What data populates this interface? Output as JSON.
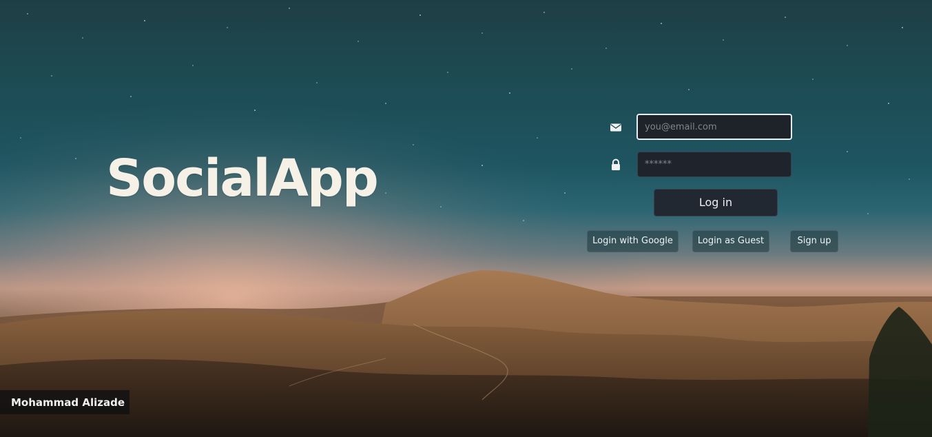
{
  "brand": {
    "title": "SocialApp"
  },
  "login_form": {
    "email_placeholder": "you@email.com",
    "email_value": "",
    "password_placeholder": "******",
    "password_value": "",
    "submit_label": "Log in"
  },
  "alt_actions": {
    "google_label": "Login with Google",
    "guest_label": "Login as Guest",
    "signup_label": "Sign up"
  },
  "photo_credit": {
    "icon": "camera-icon",
    "author": "Mohammad Alizade"
  },
  "icons": {
    "email": "envelope-icon",
    "password": "lock-icon"
  },
  "colors": {
    "brand_text": "#f6f1e6",
    "field_bg": "#1f232b",
    "button_bg": "#222831",
    "sky_top": "#1f3e44",
    "horizon_glow": "#c79b86"
  }
}
